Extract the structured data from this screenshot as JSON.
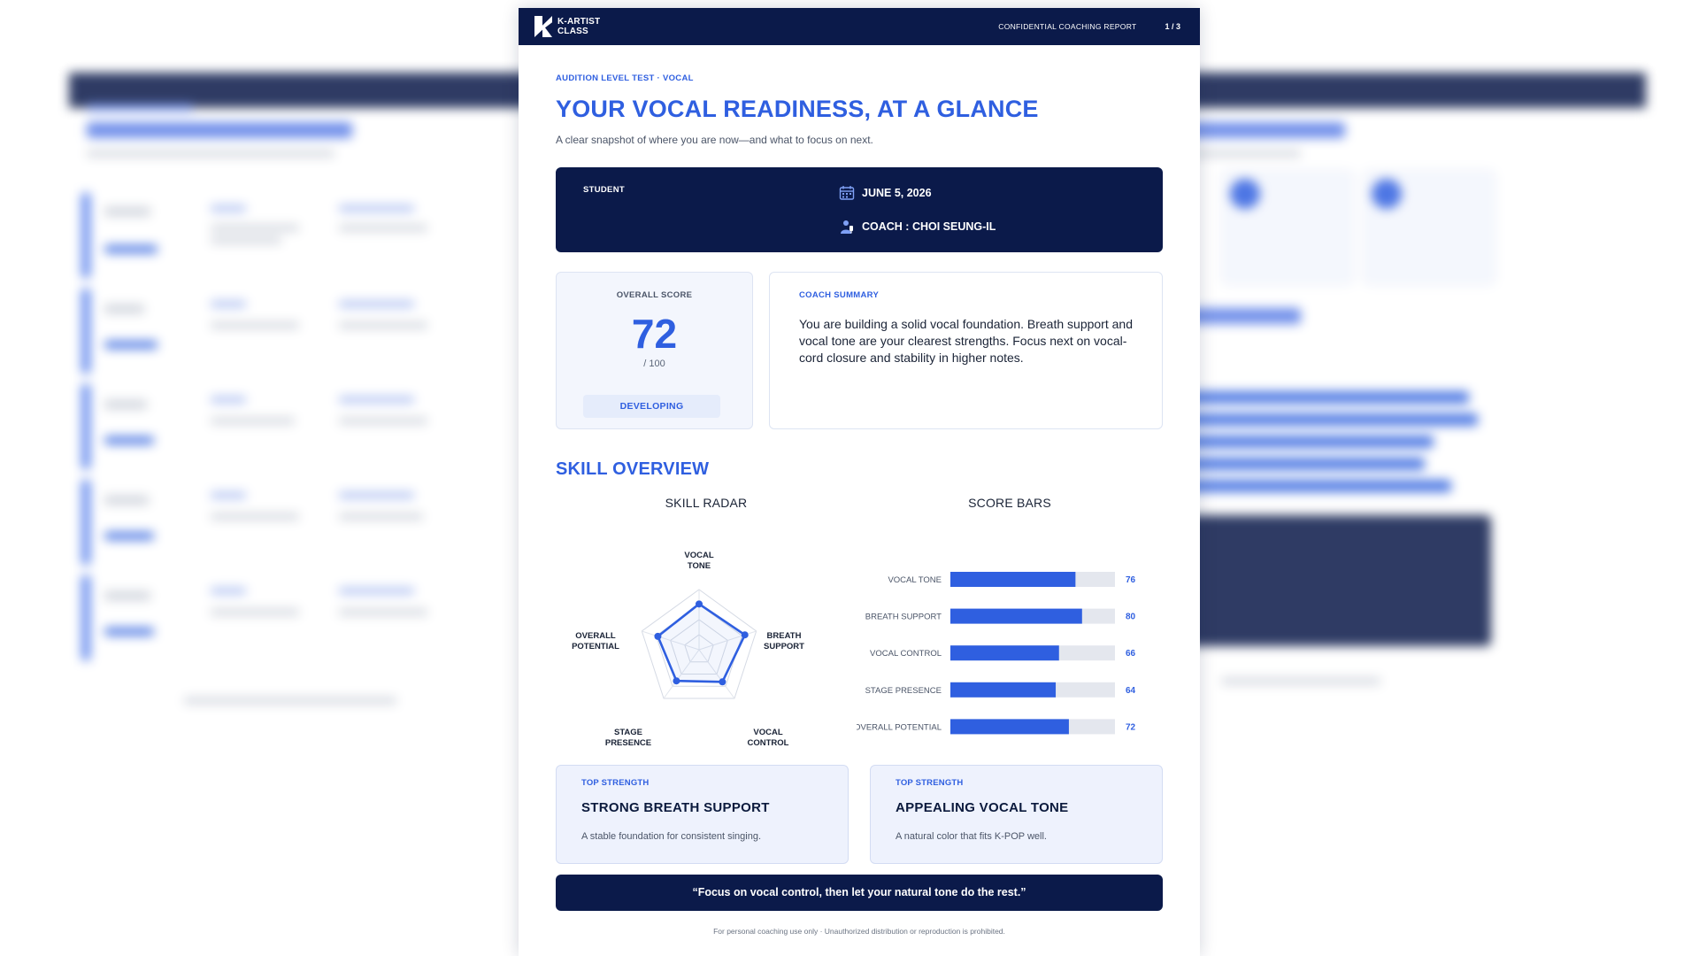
{
  "header": {
    "brand_line1": "K-ARTIST",
    "brand_line2": "CLASS",
    "report_label": "CONFIDENTIAL COACHING REPORT",
    "page_indicator": "1 / 3"
  },
  "intro": {
    "kicker": "AUDITION LEVEL TEST · VOCAL",
    "title": "YOUR VOCAL READINESS, AT A GLANCE",
    "subtitle": "A clear snapshot of where you are now—and what to focus on next."
  },
  "student_panel": {
    "student_label": "STUDENT",
    "date": "JUNE 5, 2026",
    "coach": "COACH : CHOI SEUNG-IL",
    "date_icon": "calendar-icon",
    "coach_icon": "coach-icon"
  },
  "score": {
    "label": "OVERALL SCORE",
    "value": "72",
    "max": "/ 100",
    "level": "DEVELOPING"
  },
  "summary": {
    "label": "COACH SUMMARY",
    "text": "You are building a solid vocal foundation. Breath support and vocal tone are your clearest strengths. Focus next on vocal-cord closure and stability in higher notes."
  },
  "skill_overview": {
    "title": "SKILL OVERVIEW",
    "radar_title": "SKILL RADAR",
    "bars_title": "SCORE BARS"
  },
  "chart_data": [
    {
      "type": "radar",
      "title": "SKILL RADAR",
      "axes": [
        [
          "VOCAL",
          "TONE"
        ],
        [
          "BREATH",
          "SUPPORT"
        ],
        [
          "VOCAL",
          "CONTROL"
        ],
        [
          "STAGE",
          "PRESENCE"
        ],
        [
          "OVERALL",
          "POTENTIAL"
        ]
      ],
      "values": [
        76,
        80,
        66,
        64,
        72
      ],
      "max": 100,
      "color": "#2f5fe0"
    },
    {
      "type": "bar",
      "orientation": "horizontal",
      "title": "SCORE BARS",
      "categories": [
        "VOCAL TONE",
        "BREATH SUPPORT",
        "VOCAL CONTROL",
        "STAGE PRESENCE",
        "OVERALL POTENTIAL"
      ],
      "values": [
        76,
        80,
        66,
        64,
        72
      ],
      "xlim": [
        0,
        100
      ],
      "color": "#2f5fe0",
      "track_color": "#e4e7ee"
    }
  ],
  "strengths": [
    {
      "kicker": "TOP STRENGTH",
      "title": "STRONG BREATH SUPPORT",
      "desc": "A stable foundation for consistent singing."
    },
    {
      "kicker": "TOP STRENGTH",
      "title": "APPEALING VOCAL TONE",
      "desc": "A natural color that fits K-POP well."
    }
  ],
  "quote": "“Focus on vocal control, then let your natural tone do the rest.”",
  "footer": "For personal coaching use only · Unauthorized distribution or reproduction is prohibited.",
  "colors": {
    "navy": "#0b1a4a",
    "accent": "#2f5fe0"
  }
}
